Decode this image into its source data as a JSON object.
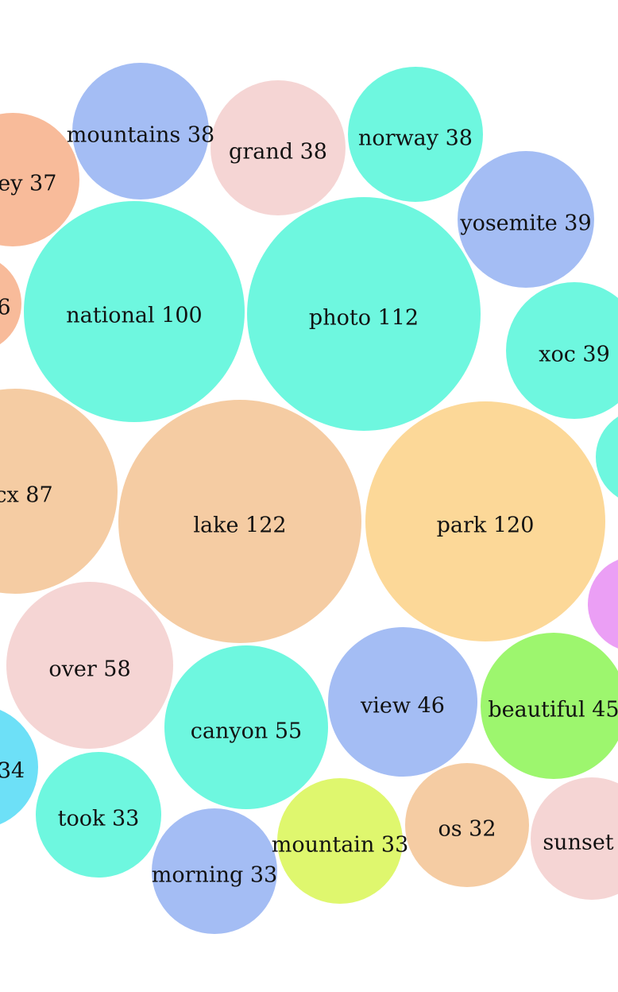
{
  "chart_data": {
    "type": "bubble",
    "title": "",
    "bubbles": [
      {
        "word": "lake",
        "count": 122,
        "label": "lake 122",
        "color": "#f5cca3"
      },
      {
        "word": "park",
        "count": 120,
        "label": "park 120",
        "color": "#fcd898"
      },
      {
        "word": "photo",
        "count": 112,
        "label": "photo 112",
        "color": "#6ef7df"
      },
      {
        "word": "national",
        "count": 100,
        "label": "national 100",
        "color": "#6ef7df"
      },
      {
        "word": "",
        "count": 87,
        "label": "cx 87",
        "color": "#f5cca3"
      },
      {
        "word": "over",
        "count": 58,
        "label": "over 58",
        "color": "#f5d5d4"
      },
      {
        "word": "canyon",
        "count": 55,
        "label": "canyon 55",
        "color": "#6ef7df"
      },
      {
        "word": "view",
        "count": 46,
        "label": "view 46",
        "color": "#a4bdf4"
      },
      {
        "word": "beautiful",
        "count": 45,
        "label": "beautiful 45",
        "color": "#9df66e"
      },
      {
        "word": "yosemite",
        "count": 39,
        "label": "yosemite 39",
        "color": "#a4bdf4"
      },
      {
        "word": "xoc",
        "count": 39,
        "label": "xoc 39",
        "color": "#6ef7df"
      },
      {
        "word": "mountains",
        "count": 38,
        "label": "mountains 38",
        "color": "#a4bdf4"
      },
      {
        "word": "grand",
        "count": 38,
        "label": "grand 38",
        "color": "#f5d5d4"
      },
      {
        "word": "norway",
        "count": 38,
        "label": "norway 38",
        "color": "#6ef7df"
      },
      {
        "word": "",
        "count": 37,
        "label": "ley 37",
        "color": "#f8bb9a"
      },
      {
        "word": "",
        "count": 34,
        "label": "34",
        "color": "#6de0f7"
      },
      {
        "word": "took",
        "count": 33,
        "label": "took 33",
        "color": "#6ef7df"
      },
      {
        "word": "morning",
        "count": 33,
        "label": "morning 33",
        "color": "#a4bdf4"
      },
      {
        "word": "mountain",
        "count": 33,
        "label": "mountain 33",
        "color": "#dff76e"
      },
      {
        "word": "os",
        "count": 32,
        "label": "os 32",
        "color": "#f5cca3"
      },
      {
        "word": "sunset",
        "count": null,
        "label": "sunset",
        "color": "#f5d5d4"
      },
      {
        "word": "",
        "count": null,
        "label": "6",
        "color": "#f8bb9a"
      },
      {
        "word": "",
        "count": null,
        "label": "",
        "color": "#6ef7df"
      },
      {
        "word": "",
        "count": null,
        "label": "",
        "color": "#eb9ff5"
      }
    ]
  }
}
